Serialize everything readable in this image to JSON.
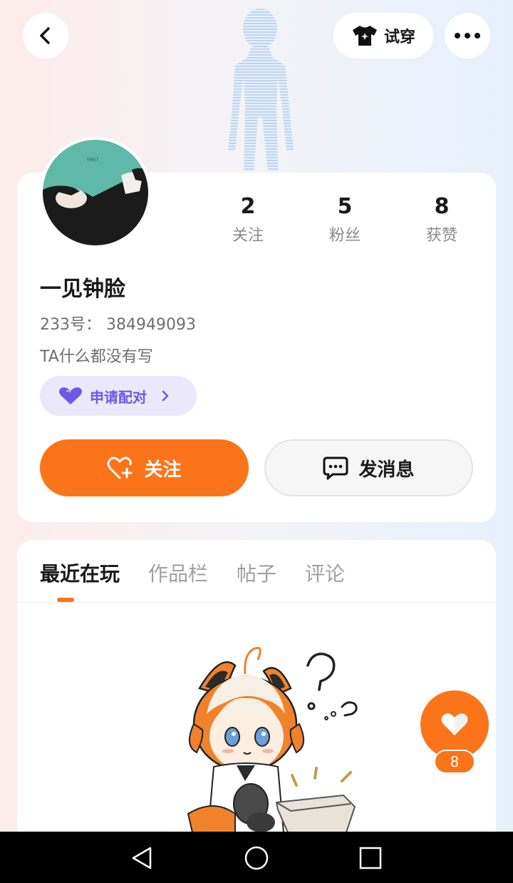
{
  "topbar": {
    "tryon_label": "试穿"
  },
  "profile": {
    "username": "一见钟脸",
    "user_id": "233号：  384949093",
    "bio": "TA什么都没有写",
    "pair_label": "申请配对",
    "stats": [
      {
        "value": "2",
        "label": "关注"
      },
      {
        "value": "5",
        "label": "粉丝"
      },
      {
        "value": "8",
        "label": "获赞"
      }
    ],
    "follow_label": "关注",
    "message_label": "发消息"
  },
  "tabs": [
    "最近在玩",
    "作品栏",
    "帖子",
    "评论"
  ],
  "active_tab": "最近在玩",
  "like_fab": {
    "count": "8"
  },
  "colors": {
    "accent": "#fb7419",
    "pair_purple": "#6f58e6",
    "pair_bg": "#ebe8fb"
  },
  "icons": [
    "back-icon",
    "tshirt-icon",
    "more-icon",
    "heart-icon",
    "heart-plus-icon",
    "chat-icon",
    "chevron-right-icon",
    "nav-back-icon",
    "nav-home-icon",
    "nav-recents-icon"
  ]
}
